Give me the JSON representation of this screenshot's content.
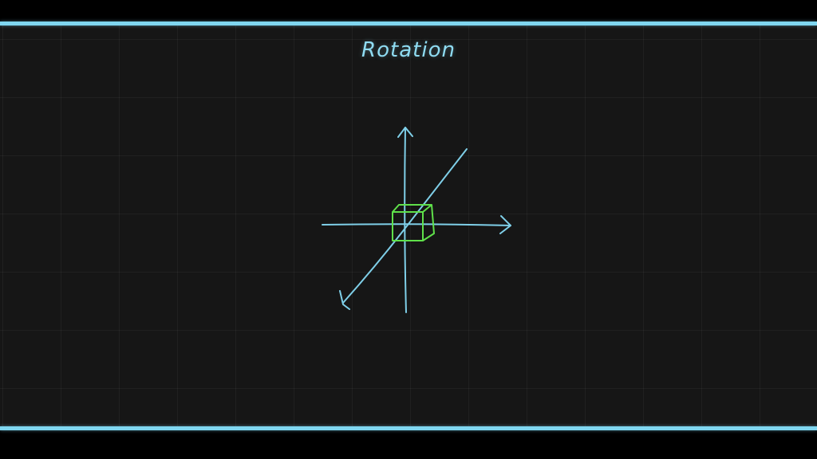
{
  "title": "Rotation",
  "colors": {
    "background": "#161616",
    "frame": "#000000",
    "rule": "#7fd6f0",
    "axis": "#7fcfe8",
    "cube": "#5fe04a",
    "title": "#8fdcf2"
  },
  "diagram": {
    "axes": [
      "x-axis",
      "y-axis",
      "z-axis"
    ],
    "object": "cube"
  }
}
